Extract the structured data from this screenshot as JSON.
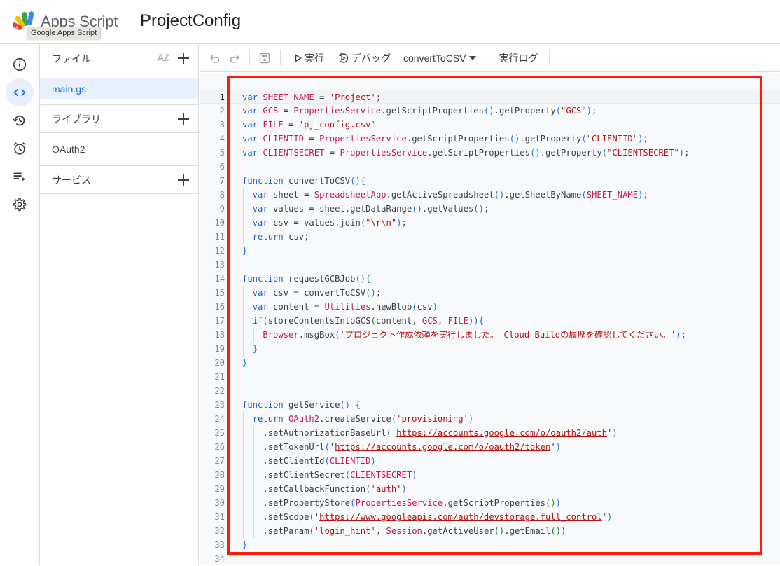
{
  "header": {
    "app_name": "Apps Script",
    "project_title": "ProjectConfig",
    "tooltip": "Google Apps Script"
  },
  "rail": {
    "items": [
      {
        "name": "overview",
        "icon": "info-icon",
        "active": false
      },
      {
        "name": "editor",
        "icon": "code-icon",
        "active": true
      },
      {
        "name": "history",
        "icon": "history-icon",
        "active": false
      },
      {
        "name": "triggers",
        "icon": "alarm-icon",
        "active": false
      },
      {
        "name": "executions",
        "icon": "executions-icon",
        "active": false
      },
      {
        "name": "settings",
        "icon": "gear-icon",
        "active": false
      }
    ]
  },
  "files_panel": {
    "files_label": "ファイル",
    "sort_label": "AZ",
    "files": [
      {
        "name": "main.gs",
        "selected": true
      }
    ],
    "libraries_label": "ライブラリ",
    "libraries": [
      {
        "name": "OAuth2"
      }
    ],
    "services_label": "サービス"
  },
  "toolbar": {
    "run_label": "実行",
    "debug_label": "デバッグ",
    "function_selector": "convertToCSV",
    "log_label": "実行ログ"
  },
  "editor": {
    "current_line": 1,
    "lines": [
      "var SHEET_NAME = 'Project';",
      "var GCS = PropertiesService.getScriptProperties().getProperty(\"GCS\");",
      "var FILE = 'pj_config.csv'",
      "var CLIENTID = PropertiesService.getScriptProperties().getProperty(\"CLIENTID\");",
      "var CLIENTSECRET = PropertiesService.getScriptProperties().getProperty(\"CLIENTSECRET\");",
      "",
      "function convertToCSV(){",
      "  var sheet = SpreadsheetApp.getActiveSpreadsheet().getSheetByName(SHEET_NAME);",
      "  var values = sheet.getDataRange().getValues();",
      "  var csv = values.join(\"\\r\\n\");",
      "  return csv;",
      "}",
      "",
      "function requestGCBJob(){",
      "  var csv = convertToCSV();",
      "  var content = Utilities.newBlob(csv)",
      "  if(storeContentsIntoGCS(content, GCS, FILE)){",
      "    Browser.msgBox('プロジェクト作成依頼を実行しました。 Cloud Buildの履歴を確認してください。');",
      "  }",
      "}",
      "",
      "",
      "function getService() {",
      "  return OAuth2.createService('provisioning')",
      "    .setAuthorizationBaseUrl('https://accounts.google.com/o/oauth2/auth')",
      "    .setTokenUrl('https://accounts.google.com/o/oauth2/token')",
      "    .setClientId(CLIENTID)",
      "    .setClientSecret(CLIENTSECRET)",
      "    .setCallbackFunction('auth')",
      "    .setPropertyStore(PropertiesService.getScriptProperties())",
      "    .setScope('https://www.googleapis.com/auth/devstorage.full_control')",
      "    .setParam('login_hint', Session.getActiveUser().getEmail())",
      "}",
      ""
    ]
  },
  "annotation": {
    "highlight_color": "#ff1a0a"
  }
}
